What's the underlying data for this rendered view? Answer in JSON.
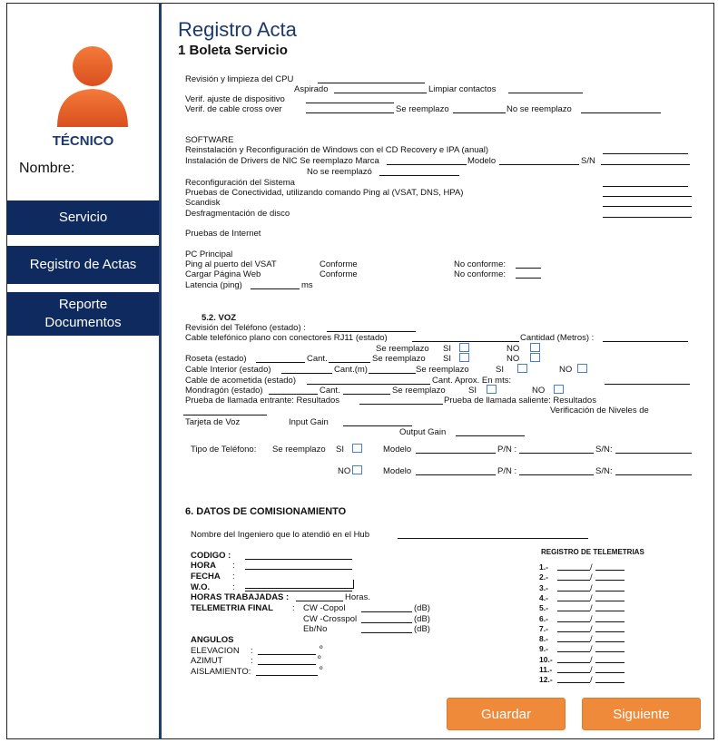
{
  "sidebar": {
    "role": "TÉCNICO",
    "nombre_label": "Nombre:",
    "items": [
      {
        "label": "Servicio"
      },
      {
        "label": "Registro  de Actas"
      },
      {
        "label": "Reporte Documentos"
      }
    ]
  },
  "header": {
    "title": "Registro Acta",
    "subtitle": "1 Boleta Servicio"
  },
  "form": {
    "cpu": {
      "revision": "Revisión y limpieza del CPU",
      "aspirado": "Aspirado",
      "limpiar": "Limpiar contactos",
      "ajuste": "Verif. ajuste de dispositivo",
      "cable": "Verif. de cable cross over",
      "se_reemplazo": "Se reemplazo",
      "no_se_reemplazo": "No se reemplazo"
    },
    "software": {
      "heading": "SOFTWARE",
      "reinstalacion": "Reinstalación y Reconfiguración de Windows con el CD Recovery e IPA (anual)",
      "drivers": "Instalación de Drivers de NIC Se reemplazo Marca",
      "modelo": "Modelo",
      "sn": "S/N",
      "no_se_reemplazo": "No se reemplazó",
      "reconfig": "Reconfiguración del Sistema",
      "pruebas_conect": "Pruebas de Conectividad, utilizando comando Ping al (VSAT, DNS, HPA)",
      "scandisk": "Scandisk",
      "desfrag": "Desfragmentación de disco",
      "pruebas_internet": "Pruebas de Internet",
      "pc_principal": "PC Principal",
      "ping_vsat": "Ping al puerto del VSAT",
      "cargar": "Cargar Página Web",
      "conforme": "Conforme",
      "no_conforme": "No conforme:",
      "latencia": "Latencia (ping)",
      "ms": "ms"
    },
    "voz": {
      "heading": "5.2.    VOZ",
      "revision_tel": "Revisión del Teléfono (estado) :",
      "cable_plano": "Cable telefónico plano con conectores RJ11 (estado)",
      "cantidad_metros": "Cantidad (Metros) :",
      "se_reemplazo": "Se reemplazo",
      "si": "SI",
      "no": "NO",
      "roseta": "Roseta (estado)",
      "cant": "Cant.",
      "cant_dot": "Cant.",
      "cable_interior": "Cable Interior (estado)",
      "cant_m": "Cant.(m)",
      "cable_acometida": "Cable de acometida (estado)",
      "cant_aprox": "Cant. Aprox. En mts:",
      "mondragon": "Mondragón (estado)",
      "llamada_entrante": "Prueba de llamada entrante: Resultados",
      "llamada_saliente": "Prueba de llamada saliente: Resultados",
      "verificacion": "Verificación de Niveles de",
      "tarjeta": "Tarjeta de Voz",
      "input_gain": "Input Gain",
      "output_gain": "Output Gain",
      "tipo_tel": "Tipo de Teléfono:",
      "tipo_se_reemplazo": "Se reemplazo",
      "modelo": "Modelo",
      "pn": "P/N :",
      "sn": "S/N:"
    },
    "datos": {
      "heading": "6.  DATOS DE COMISIONAMIENTO",
      "ingeniero": "Nombre del Ingeniero que lo atendió en el Hub",
      "codigo": "CODIGO :",
      "hora": "HORA",
      "fecha": "FECHA",
      "wo": "W.O.",
      "colon": ":",
      "horas_trabajadas": "HORAS TRABAJADAS :",
      "horas_suffix": "Horas.",
      "telemetria_final": "TELEMETRIA FINAL",
      "cw_copol": "CW -Copol",
      "cw_crosspol": "CW -Crosspol",
      "ebno": "Eb/No",
      "db": "(dB)",
      "angulos": "ANGULOS",
      "elevacion": "ELEVACION",
      "azimut": "AZIMUT",
      "aislamiento": "AISLAMIENTO:",
      "deg": "º",
      "registro_telemetrias": "REGISTRO DE TELEMETRIAS",
      "telemetrias": [
        "1.-",
        "2.-",
        "3.-",
        "4.-",
        "5.-",
        "6.-",
        "7.-",
        "8.-",
        "9.-",
        "10.-",
        "11.-",
        "12.-"
      ]
    }
  },
  "buttons": {
    "guardar": "Guardar",
    "siguiente": "Siguiente"
  },
  "colors": {
    "nav": "#0f2a5f",
    "accent": "#ef8a3b",
    "title": "#1b3a6b",
    "avatar": "#e8622c"
  }
}
